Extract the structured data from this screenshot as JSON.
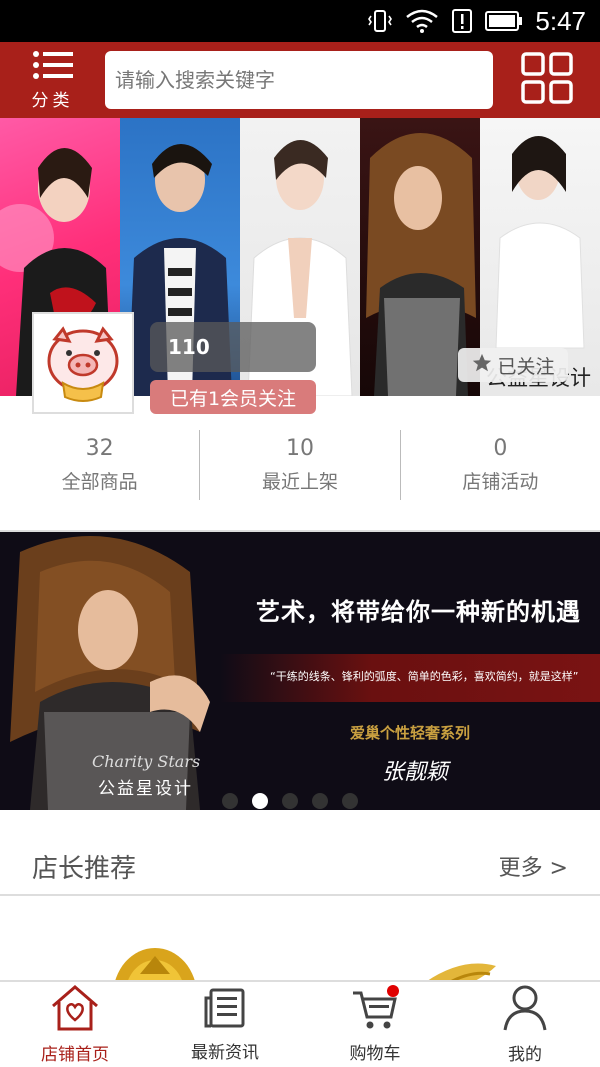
{
  "status_bar": {
    "time": "5:47"
  },
  "header": {
    "category_label": "分类",
    "search_placeholder": "请输入搜索关键字"
  },
  "shop": {
    "name": "110",
    "members_text": "已有1会员关注",
    "follow_label": "已关注",
    "banner_caption": "公益星设计"
  },
  "stats": [
    {
      "value": "32",
      "label": "全部商品"
    },
    {
      "value": "10",
      "label": "最近上架"
    },
    {
      "value": "0",
      "label": "店铺活动"
    }
  ],
  "promo": {
    "headline": "艺术，将带给你一种新的机遇",
    "quote": "“干练的线条、锋利的弧度、简单的色彩，喜欢简约，就是这样”",
    "series": "爱巢个性轻奢系列",
    "signature": "张靓颖",
    "brand_script": "Charity Stars",
    "brand_cn": "公益星设计",
    "carousel_total": 5,
    "carousel_active": 2
  },
  "section": {
    "title": "店长推荐",
    "more_label": "更多 >"
  },
  "tabs": [
    {
      "label": "店铺首页",
      "icon": "home-heart-icon",
      "active": true
    },
    {
      "label": "最新资讯",
      "icon": "news-icon",
      "active": false
    },
    {
      "label": "购物车",
      "icon": "cart-icon",
      "active": false
    },
    {
      "label": "我的",
      "icon": "user-icon",
      "active": false
    }
  ],
  "colors": {
    "brand": "#a8201a",
    "members_badge": "#d97b7b",
    "cart_dot": "#e00000"
  }
}
